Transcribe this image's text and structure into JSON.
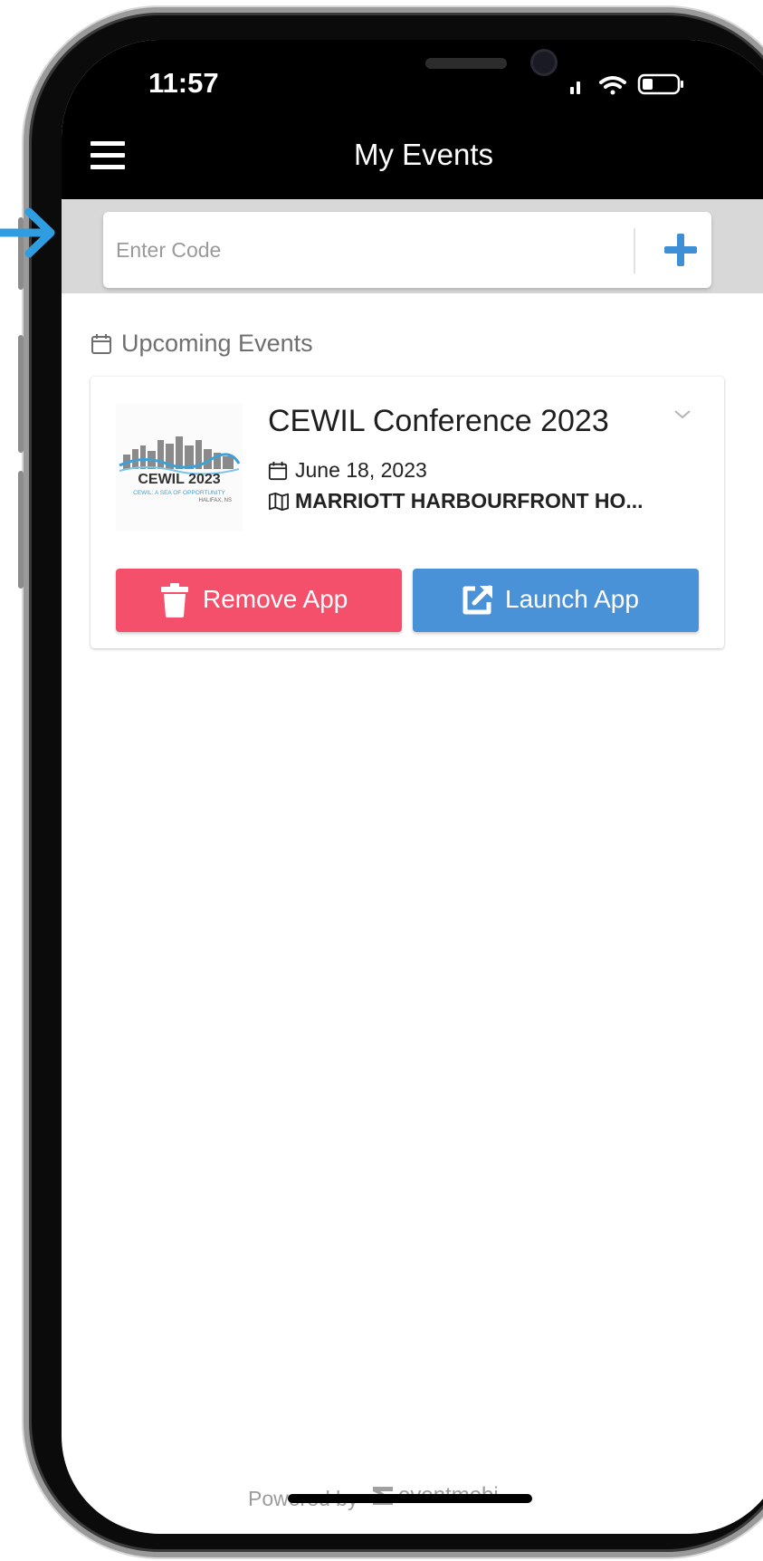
{
  "status_bar": {
    "time": "11:57"
  },
  "header": {
    "title": "My Events"
  },
  "code_entry": {
    "placeholder": "Enter Code"
  },
  "section": {
    "label": "Upcoming Events"
  },
  "event": {
    "title": "CEWIL Conference 2023",
    "date": "June 18, 2023",
    "venue": "MARRIOTT HARBOURFRONT HO...",
    "logo_text": "CEWIL 2023",
    "logo_tagline": "CEWIL: A SEA OF OPPORTUNITY",
    "logo_location": "HALIFAX, NS"
  },
  "actions": {
    "remove_label": "Remove App",
    "launch_label": "Launch App"
  },
  "footer": {
    "powered_by": "Powered by",
    "brand": "eventmobi"
  },
  "icons": {
    "menu": "hamburger-menu-icon",
    "add": "plus-icon",
    "calendar": "calendar-icon",
    "map": "map-icon",
    "expand": "chevron-down-icon",
    "remove": "trash-icon",
    "launch": "external-link-icon",
    "brand": "eventmobi-logo-icon",
    "pointer": "arrow-right-icon"
  },
  "colors": {
    "header_bg": "#000000",
    "code_band_bg": "#d8d8d8",
    "accent_blue": "#4a92d8",
    "remove_red": "#f5506b",
    "pointer_blue": "#2f9de0"
  }
}
